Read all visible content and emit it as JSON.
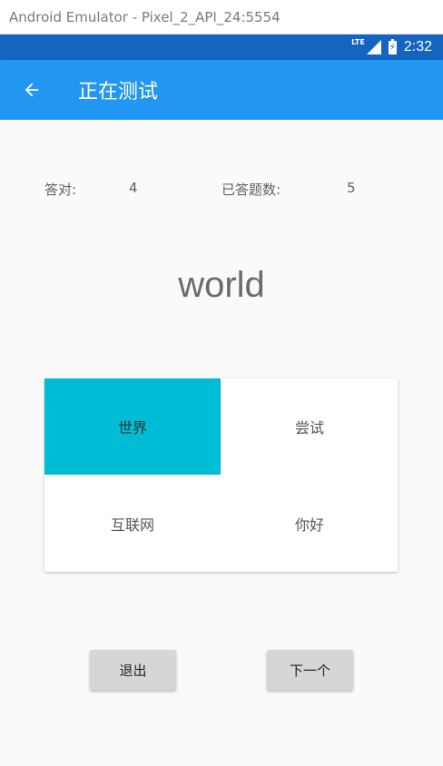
{
  "window": {
    "title": "Android Emulator - Pixel_2_API_24:5554"
  },
  "statusbar": {
    "network": "LTE",
    "time": "2:32"
  },
  "appbar": {
    "title": "正在测试",
    "back_icon": "arrow-left-icon"
  },
  "stats": {
    "correct_label": "答对:",
    "correct_value": "4",
    "answered_label": "已答题数:",
    "answered_value": "5"
  },
  "question": {
    "word": "world"
  },
  "options": [
    {
      "label": "世界",
      "selected": true
    },
    {
      "label": "尝试",
      "selected": false
    },
    {
      "label": "互联网",
      "selected": false
    },
    {
      "label": "你好",
      "selected": false
    }
  ],
  "buttons": {
    "exit": "退出",
    "next": "下一个"
  },
  "colors": {
    "appbar": "#2196f3",
    "statusbar": "#1565c0",
    "selected": "#00bcd4"
  }
}
